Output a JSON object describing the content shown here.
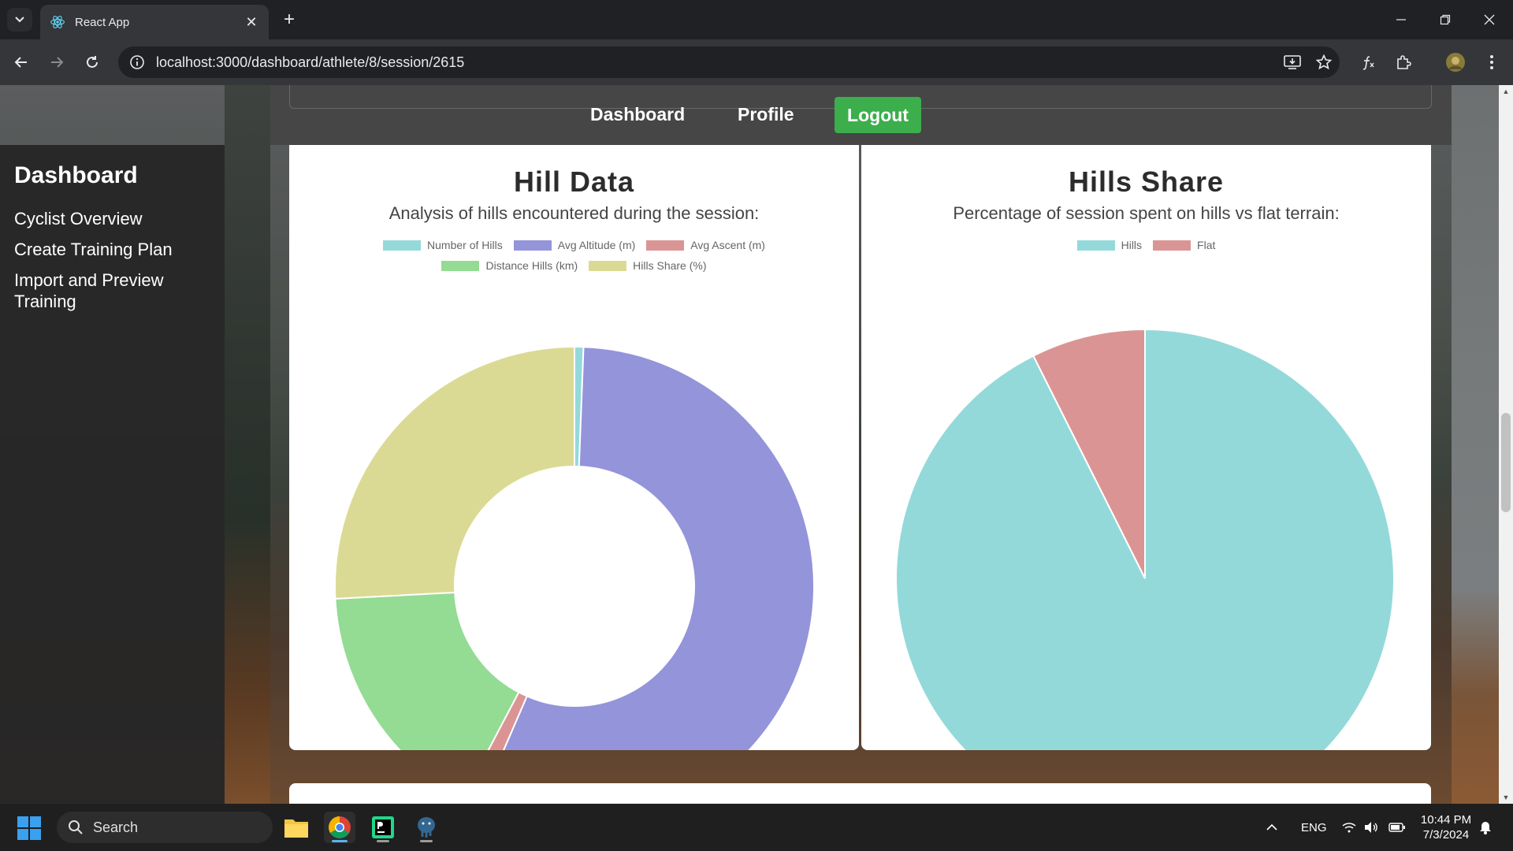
{
  "browser": {
    "tab_title": "React App",
    "tab_close": "✕",
    "new_tab": "+",
    "url": "localhost:3000/dashboard/athlete/8/session/2615"
  },
  "sidebar": {
    "title": "Dashboard",
    "items": [
      {
        "label": "Cyclist Overview"
      },
      {
        "label": "Create Training Plan"
      },
      {
        "label": "Import and Preview Training"
      }
    ]
  },
  "topnav": {
    "dashboard": "Dashboard",
    "profile": "Profile",
    "logout": "Logout"
  },
  "hill_data": {
    "title": "Hill Data",
    "subtitle": "Analysis of hills encountered during the session:"
  },
  "hills_share": {
    "title": "Hills Share",
    "subtitle": "Percentage of session spent on hills vs flat terrain:"
  },
  "chart_data": [
    {
      "type": "pie",
      "variant": "doughnut",
      "title": "Hill Data",
      "legend_position": "top",
      "categories": [
        "Number of Hills",
        "Avg Altitude (m)",
        "Avg Ascent (m)",
        "Distance Hills (km)",
        "Hills Share (%)"
      ],
      "values": [
        4,
        370,
        8,
        109,
        171
      ],
      "colors": [
        "#94d9da",
        "#9494db",
        "#db9494",
        "#94db94",
        "#dbda94"
      ]
    },
    {
      "type": "pie",
      "title": "Hills Share",
      "legend_position": "top",
      "categories": [
        "Hills",
        "Flat"
      ],
      "values": [
        92.6,
        7.4
      ],
      "colors": [
        "#94d9da",
        "#db9494"
      ]
    }
  ],
  "taskbar": {
    "search_placeholder": "Search",
    "language": "ENG",
    "time": "10:44 PM",
    "date": "7/3/2024"
  },
  "icons": {
    "tab_menu": "chevron-down-icon",
    "close": "close-icon",
    "back": "back-arrow-icon",
    "forward": "forward-arrow-icon",
    "reload": "reload-icon",
    "info": "info-icon",
    "install": "install-app-icon",
    "bookmark": "star-icon",
    "extensions": "puzzle-icon",
    "profile": "avatar-icon",
    "menu": "kebab-menu-icon"
  }
}
